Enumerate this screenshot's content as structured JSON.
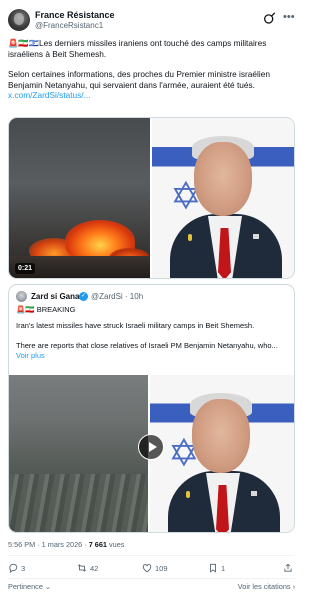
{
  "author": {
    "name": "France Résistance",
    "handle": "@FranceRsistanc1"
  },
  "tweet": {
    "emoji_prefix": "🚨🇮🇷🇮🇱",
    "text_line1": "Les derniers missiles iraniens ont touché des camps militaires israéliens à Beit Shemesh.",
    "text_line2": "Selon certaines informations, des proches du Premier ministre israélien Benjamin Netanyahu, qui servaient dans l'armée, auraient été tués.",
    "link": "x.com/ZardSi/status/...",
    "video_duration": "0:21"
  },
  "quote": {
    "name": "Zard si Gana",
    "handle": "@ZardSi · 10h",
    "badge": "🚨🇮🇷 BREAKING",
    "text_line1": "Iran's latest missiles have struck Israeli military camps in Beit Shemesh.",
    "text_line2": "There are reports that close relatives of Israeli PM Benjamin Netanyahu, who...",
    "show_more": "Voir plus"
  },
  "meta": {
    "time": "5:56 PM · 1 mars 2026 · ",
    "views_count": "7 661",
    "views_label": " vues"
  },
  "actions": {
    "replies": "3",
    "reposts": "42",
    "likes": "109",
    "bookmarks": "1"
  },
  "footer": {
    "relevance": "Pertinence",
    "quotes": "Voir les citations"
  },
  "icons": {
    "reply": "reply-icon",
    "repost": "repost-icon",
    "like": "heart-icon",
    "bookmark": "bookmark-icon",
    "share": "share-icon",
    "more": "more-icon",
    "grok": "grok-icon"
  },
  "colors": {
    "link": "#1d9bf0",
    "muted": "#536471",
    "text": "#0f1419"
  }
}
